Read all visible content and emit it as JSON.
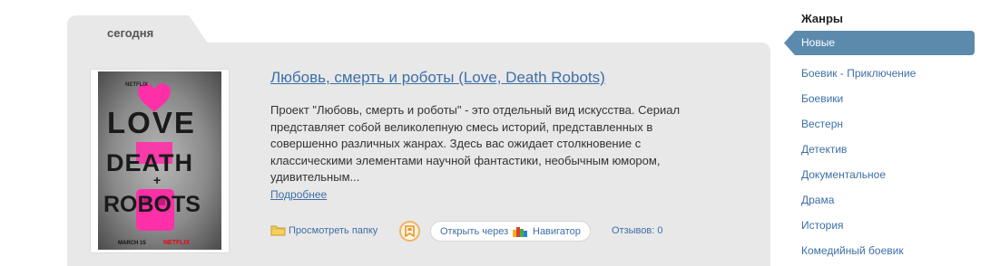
{
  "feed": {
    "tab_label": "сегодня"
  },
  "film": {
    "title": "Любовь, смерть и роботы (Love, Death Robots)",
    "description": "Проект \"Любовь, смерть и роботы\" - это отдельный вид искусства. Сериал представляет собой великолепную смесь историй, представленных в совершенно различных жанрах. Здесь вас ожидает столкновение с классическими элементами научной фантастики, необычным юмором, удивительным...",
    "more_label": "Подробнее",
    "poster": {
      "top_text": "NETFLIX",
      "word1": "LOVE",
      "word2": "DEATH",
      "plus": "+",
      "word3": "ROBOTS",
      "date": "MARCH 15",
      "brand": "NETFLIX",
      "accent_color": "#ff2fa8"
    }
  },
  "actions": {
    "folder_label": "Просмотреть папку",
    "open_via_label": "Открыть через",
    "navigator_label": "Навигатор",
    "reviews_label": "Отзывов: 0"
  },
  "genres": {
    "title": "Жанры",
    "active": "Новые",
    "items": [
      "Боевик - Приключение",
      "Боевики",
      "Вестерн",
      "Детектив",
      "Документальное",
      "Драма",
      "История",
      "Комедийный боевик"
    ]
  },
  "colors": {
    "link": "#3d6fa6",
    "active_genre": "#5b8aad",
    "card_bg": "#e8e8e8"
  }
}
